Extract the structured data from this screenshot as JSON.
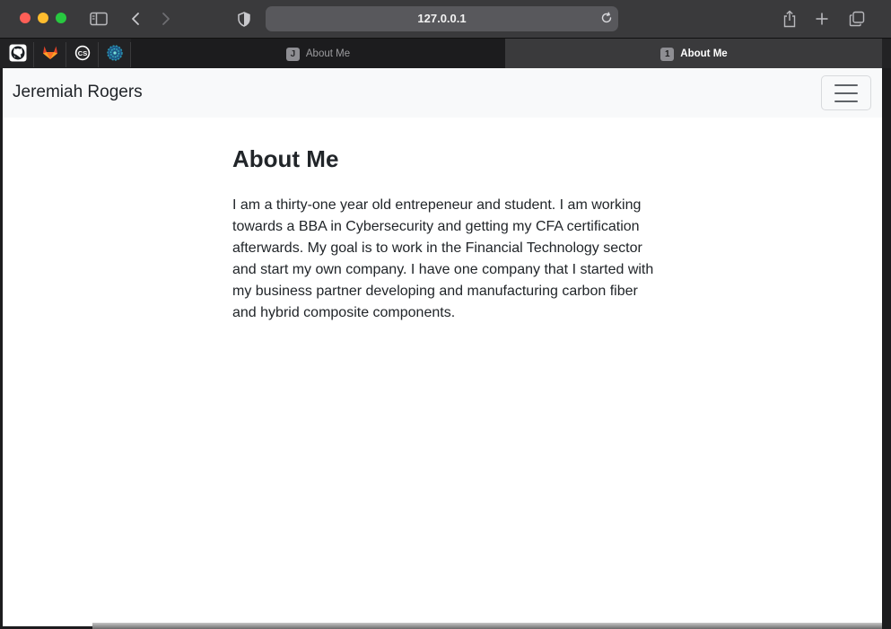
{
  "browser": {
    "url": "127.0.0.1",
    "favorites": [
      {
        "icon": "github-icon"
      },
      {
        "icon": "gitlab-icon"
      },
      {
        "icon": "cs-icon"
      },
      {
        "icon": "globe-icon"
      }
    ],
    "tabs": [
      {
        "badge": "J",
        "label": "About Me",
        "active": false
      },
      {
        "badge": "1",
        "label": "About Me",
        "active": true
      }
    ]
  },
  "navbar": {
    "brand": "Jeremiah Rogers"
  },
  "main": {
    "heading": "About Me",
    "paragraph": "I am a thirty-one year old entrepeneur and student. I am working towards a BBA in Cybersecurity and getting my CFA certification afterwards. My goal is to work in the Financial Technology sector and start my own company. I have one company that I started with my business partner developing and manufacturing carbon fiber and hybrid composite components."
  },
  "colors": {
    "close": "#ff5f57",
    "minimize": "#febc2e",
    "zoom": "#28c840",
    "navbar_bg": "#f8f9fa",
    "text": "#212529"
  }
}
